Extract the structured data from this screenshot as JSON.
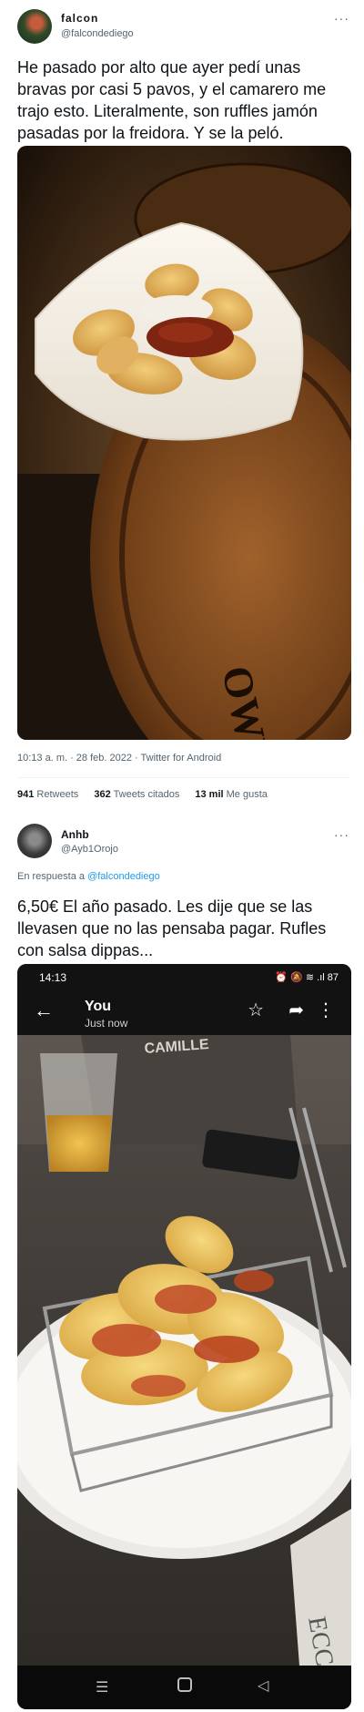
{
  "tweet1": {
    "name": "falcon",
    "handle": "@falcondediego",
    "more": "···",
    "text": "He pasado por alto que ayer pedí unas bravas por casi 5 pavos, y el camarero me trajo esto. Literalmente, son ruffles jamón pasadas por la freidora. Y se la peló.",
    "meta": "10:13 a. m. · 28 feb. 2022 · Twitter for Android",
    "stats": {
      "retweets_count": "941",
      "retweets_label": "Retweets",
      "quotes_count": "362",
      "quotes_label": "Tweets citados",
      "likes_count": "13 mil",
      "likes_label": "Me gusta"
    },
    "photo_sign_text": "OWN AL"
  },
  "tweet2": {
    "name": "Anhb",
    "handle": "@Ayb1Orojo",
    "more": "···",
    "reply_prefix": "En respuesta a",
    "reply_handle": "@falcondediego",
    "text": "6,50€ El año pasado. Les dije que se las llevasen que no las pensaba pagar. Rufles con salsa dippas...",
    "phone": {
      "time": "14:13",
      "status_icons": "⏰ 🔕 ≋ .ıl 87",
      "chat_title": "You",
      "chat_subtitle": "Just now",
      "shirt_text": "CAMILLE",
      "corner_text": "ECC"
    }
  },
  "colors": {
    "text_primary": "#0f1419",
    "text_secondary": "#536471",
    "link": "#1d9bf0",
    "divider": "#eff3f4"
  }
}
